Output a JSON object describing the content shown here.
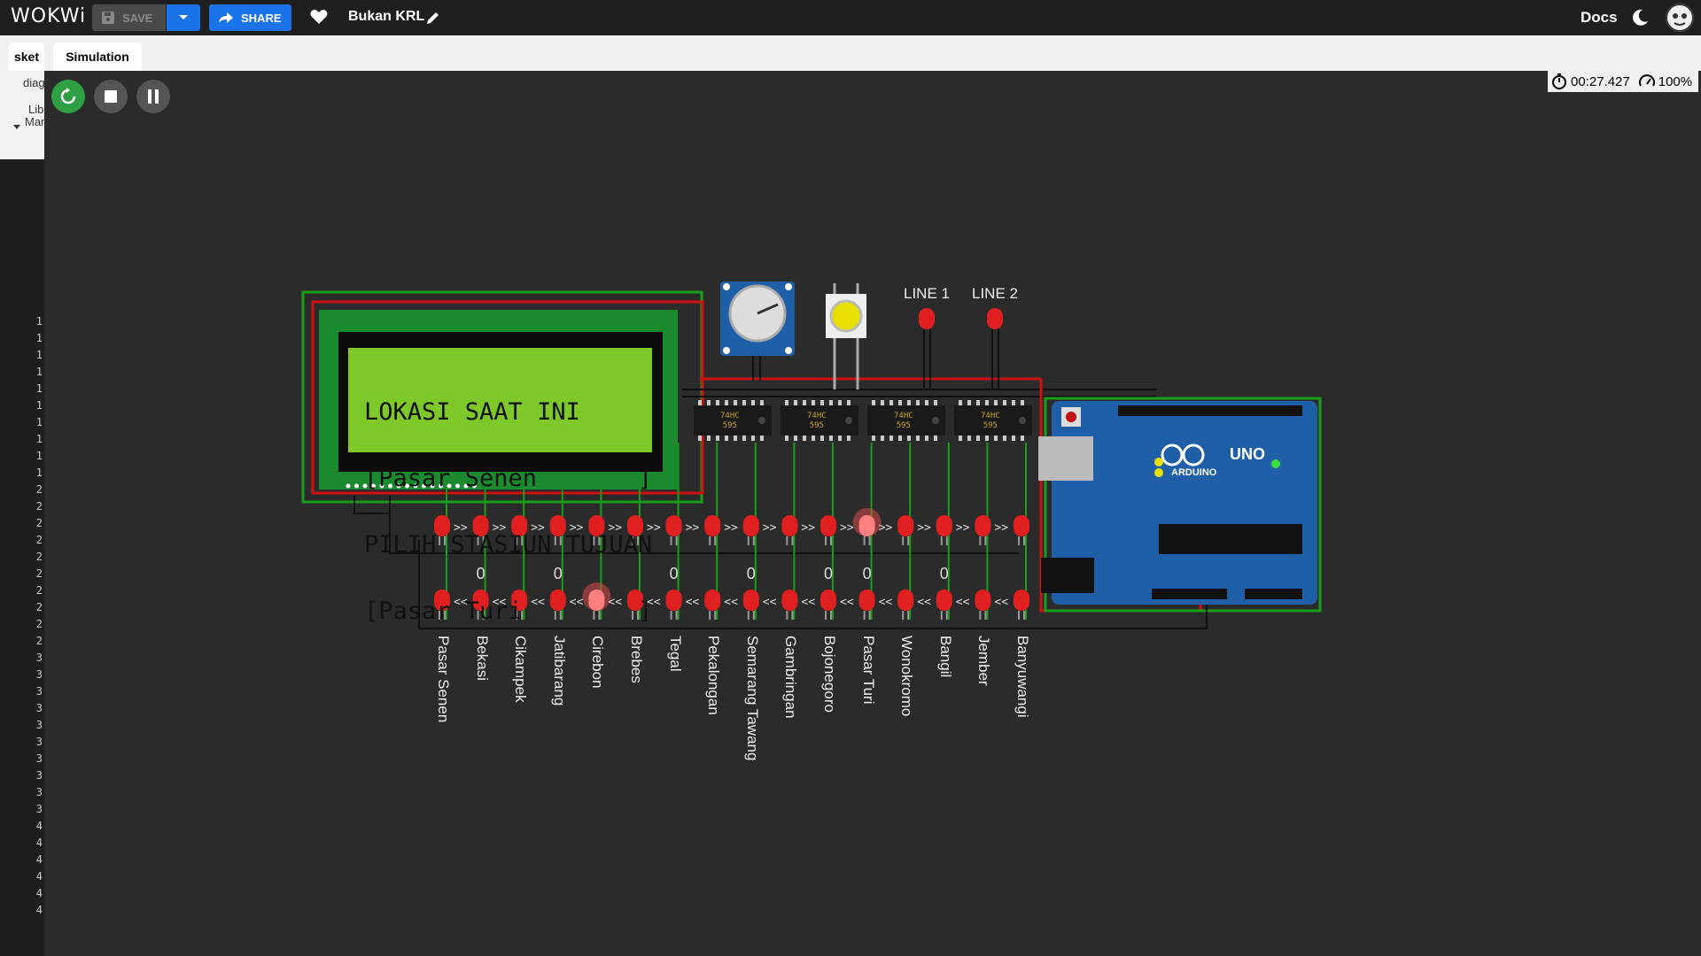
{
  "topbar": {
    "logo": "WOKWi",
    "save_label": "SAVE",
    "share_label": "SHARE",
    "project_name": "Bukan KRL",
    "docs_label": "Docs"
  },
  "tabs": [
    {
      "label": "sket"
    },
    {
      "label": "Simulation"
    }
  ],
  "editor": {
    "files": [
      "diag",
      "Lib",
      "Man"
    ],
    "line_numbers": [
      "1",
      "1",
      "1",
      "1",
      "1",
      "1",
      "1",
      "1",
      "1",
      "1",
      "2",
      "2",
      "2",
      "2",
      "2",
      "2",
      "2",
      "2",
      "2",
      "2",
      "3",
      "3",
      "3",
      "3",
      "3",
      "3",
      "3",
      "3",
      "3",
      "3",
      "4",
      "4",
      "4",
      "4",
      "4",
      "4"
    ]
  },
  "simulation": {
    "timer": "00:27.427",
    "speed": "100%",
    "lcd_lines": [
      "LOKASI SAAT INI",
      "[Pasar Senen       ]",
      "PILIH STASIUN TUJUAN",
      "[Pasar Turi        ]"
    ],
    "shift_register_label": "74HC\n595",
    "line_labels": [
      "LINE 1",
      "LINE 2"
    ],
    "arduino_label": "UNO",
    "arduino_brand": "ARDUINO",
    "stations": [
      "Pasar Senen",
      "Bekasi",
      "Cikampek",
      "Jatibarang",
      "Cirebon",
      "Brebes",
      "Tegal",
      "Pekalongan",
      "Semarang Tawang",
      "Gambringan",
      "Bojonegoro",
      "Pasar Turi",
      "Wonokromo",
      "Bangil",
      "Jember",
      "Banyuwangi"
    ],
    "zero_markers": [
      "0",
      "0",
      "0",
      "0",
      "0",
      "0",
      "0"
    ],
    "top_row_lit_index": 11,
    "bottom_row_lit_index": 4,
    "colors": {
      "accent": "#1a73e8",
      "led_red": "#e02020",
      "lcd_green": "#7ec82a",
      "board_blue": "#1f5fa8",
      "wire_green": "#1a9e1a"
    }
  }
}
